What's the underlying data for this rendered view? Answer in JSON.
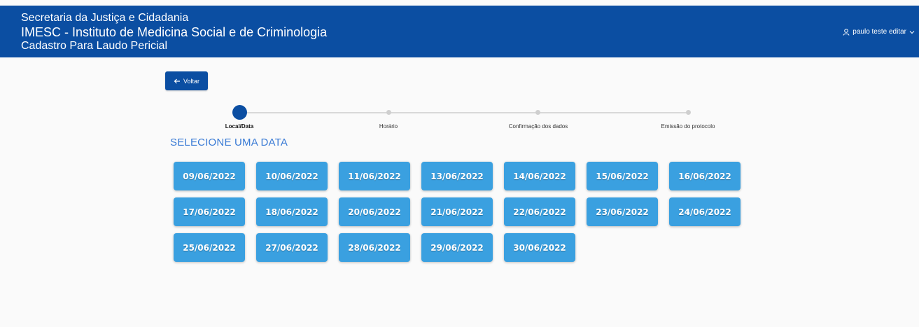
{
  "header": {
    "line1": "Secretaria da Justiça e Cidadania",
    "line2": "IMESC - Instituto de Medicina Social e de Criminologia",
    "line3": "Cadastro Para Laudo Pericial",
    "user_name": "paulo teste editar",
    "brand_color": "#0b4ea2"
  },
  "back_button": {
    "label": "Voltar",
    "icon": "arrow-left-icon"
  },
  "stepper": {
    "active_index": 0,
    "steps": [
      {
        "label": "Local/Data"
      },
      {
        "label": "Horário"
      },
      {
        "label": "Confirmação dos dados"
      },
      {
        "label": "Emissão do protocolo"
      }
    ]
  },
  "section_title": "SELECIONE UMA DATA",
  "dates": [
    "09/06/2022",
    "10/06/2022",
    "11/06/2022",
    "13/06/2022",
    "14/06/2022",
    "15/06/2022",
    "16/06/2022",
    "17/06/2022",
    "18/06/2022",
    "20/06/2022",
    "21/06/2022",
    "22/06/2022",
    "23/06/2022",
    "24/06/2022",
    "25/06/2022",
    "27/06/2022",
    "28/06/2022",
    "29/06/2022",
    "30/06/2022"
  ],
  "date_button_color": "#3aa0e0"
}
